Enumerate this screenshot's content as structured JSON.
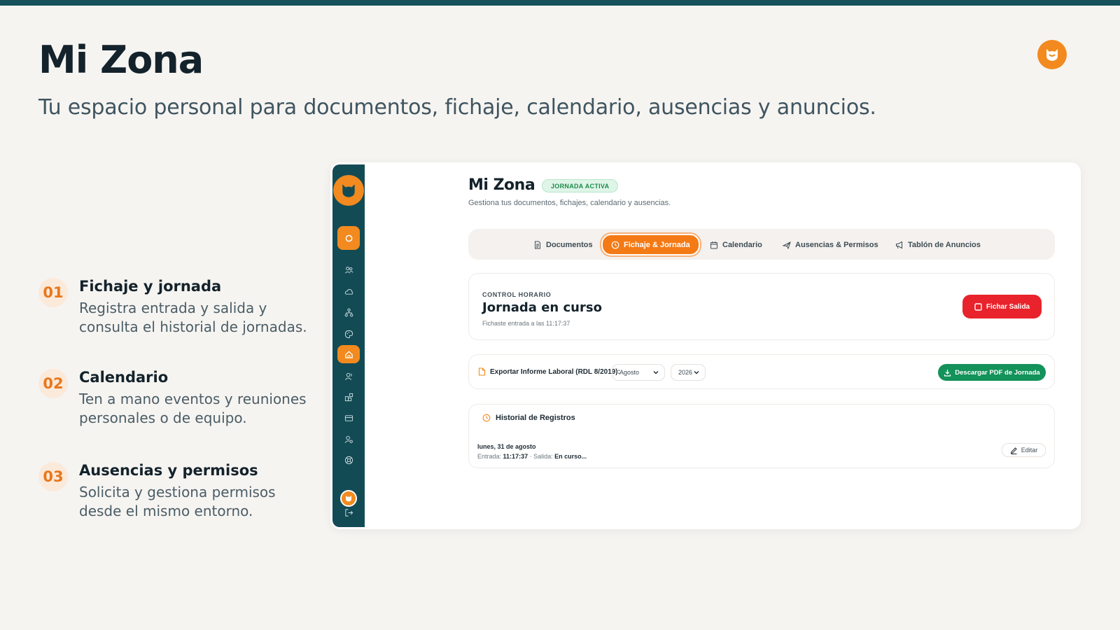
{
  "page": {
    "title": "Mi Zona",
    "subtitle": "Tu espacio personal para documentos, fichaje, calendario, ausencias y anuncios."
  },
  "features": [
    {
      "num": "01",
      "title": "Fichaje y jornada",
      "desc": "Registra entrada y salida y consulta el historial de jornadas."
    },
    {
      "num": "02",
      "title": "Calendario",
      "desc": "Ten a mano eventos y reuniones personales o de equipo."
    },
    {
      "num": "03",
      "title": "Ausencias y permisos",
      "desc": "Solicita y gestiona permisos desde el mismo entorno."
    }
  ],
  "app": {
    "title": "Mi Zona",
    "badge": "JORNADA ACTIVA",
    "subtitle": "Gestiona tus documentos, fichajes, calendario y ausencias.",
    "tabs": [
      {
        "label": "Documentos",
        "icon": "document-icon"
      },
      {
        "label": "Fichaje & Jornada",
        "icon": "clock-icon",
        "active": true
      },
      {
        "label": "Calendario",
        "icon": "calendar-icon"
      },
      {
        "label": "Ausencias & Permisos",
        "icon": "plane-icon"
      },
      {
        "label": "Tablón de Anuncios",
        "icon": "megaphone-icon"
      }
    ],
    "control": {
      "eyebrow": "CONTROL HORARIO",
      "title": "Jornada en curso",
      "subtitle": "Fichaste entrada a las 11:17:37",
      "button": "Fichar Salida"
    },
    "export": {
      "label": "Exportar Informe Laboral (RDL 8/2019):",
      "month": "Agosto",
      "year": "2026",
      "button": "Descargar PDF de Jornada"
    },
    "history": {
      "title": "Historial de Registros",
      "date": "lunes, 31 de agosto",
      "entry_label": "Entrada:",
      "entry_time": "11:17:37",
      "sep": "·",
      "exit_label": "Salida:",
      "exit_value": "En curso...",
      "edit": "Editar"
    },
    "sidebar_icons": [
      "home-icon",
      "users-icon",
      "cloud-icon",
      "org-icon",
      "palette-icon",
      "home-icon",
      "user-icon",
      "apps-icon",
      "card-icon",
      "user-settings-icon",
      "help-icon",
      "logout-icon"
    ]
  },
  "colors": {
    "accent": "#f28a1f",
    "sidebar": "#134b55",
    "danger": "#e8232b",
    "success": "#13925a"
  }
}
